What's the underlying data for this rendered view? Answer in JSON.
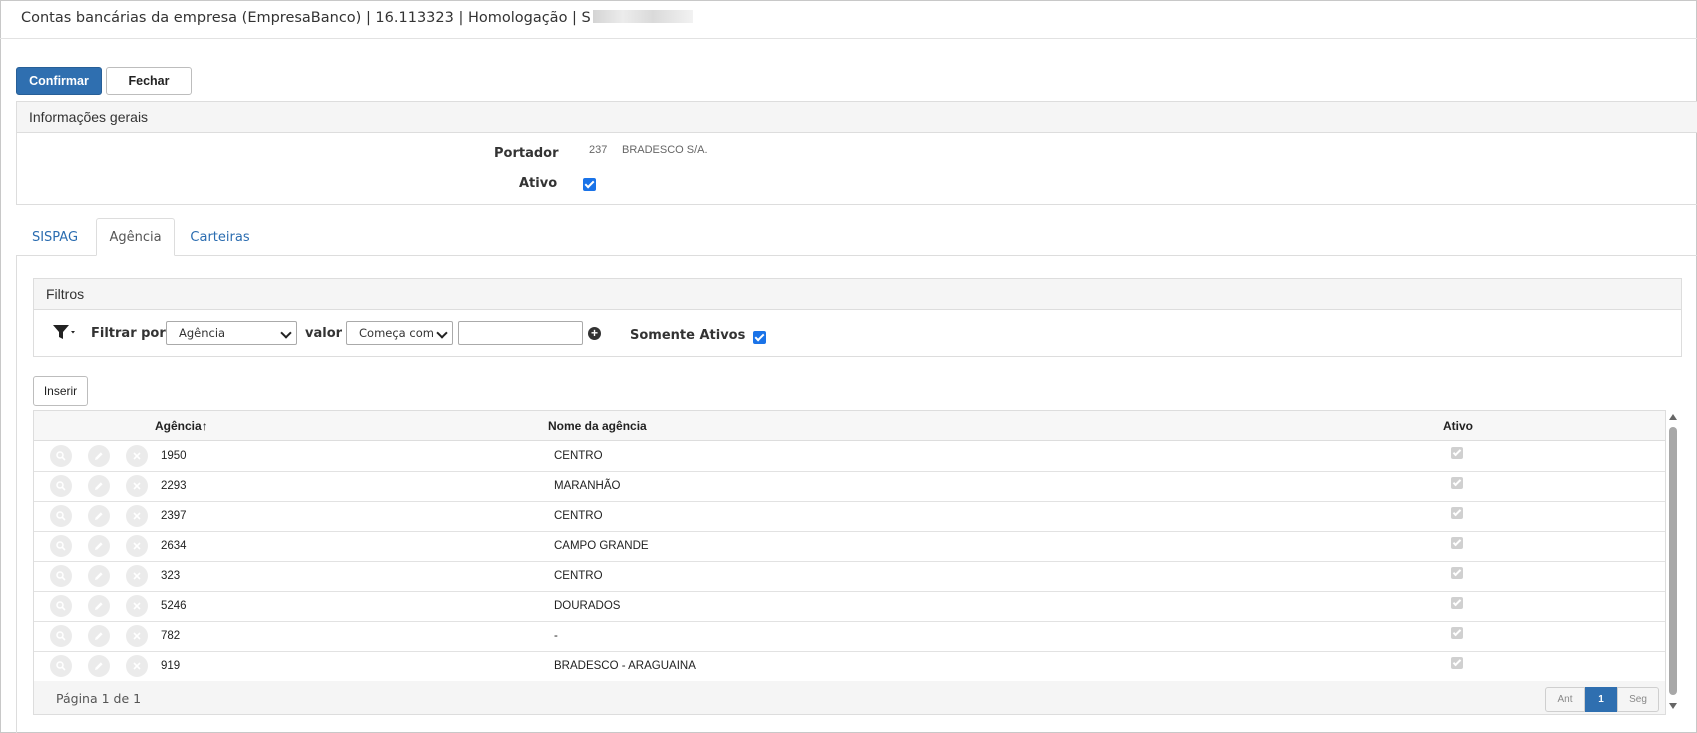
{
  "window": {
    "title": "Contas bancárias da empresa (EmpresaBanco) | 16.113323 | Homologação | S"
  },
  "toolbar": {
    "confirm_label": "Confirmar",
    "close_label": "Fechar"
  },
  "info": {
    "section_title": "Informações gerais",
    "portador_label": "Portador",
    "portador_code": "237",
    "portador_name": "BRADESCO S/A.",
    "ativo_label": "Ativo",
    "ativo_checked": true
  },
  "tabs": [
    {
      "label": "SISPAG",
      "active": false
    },
    {
      "label": "Agência",
      "active": true
    },
    {
      "label": "Carteiras",
      "active": false
    }
  ],
  "filters": {
    "title": "Filtros",
    "filter_by_label": "Filtrar por",
    "filter_by_value": "Agência",
    "value_label": "valor",
    "operator_value": "Começa com",
    "text_value": "",
    "only_active_label": "Somente Ativos",
    "only_active_checked": true
  },
  "insert_label": "Inserir",
  "grid": {
    "columns": [
      "Agência",
      "Nome da agência",
      "Ativo"
    ],
    "sort_indicator": "↑",
    "rows": [
      {
        "agencia": "1950",
        "nome": "CENTRO",
        "ativo": true
      },
      {
        "agencia": "2293",
        "nome": "MARANHÃO",
        "ativo": true
      },
      {
        "agencia": "2397",
        "nome": "CENTRO",
        "ativo": true
      },
      {
        "agencia": "2634",
        "nome": "CAMPO GRANDE",
        "ativo": true
      },
      {
        "agencia": "323",
        "nome": "CENTRO",
        "ativo": true
      },
      {
        "agencia": "5246",
        "nome": "DOURADOS",
        "ativo": true
      },
      {
        "agencia": "782",
        "nome": "-",
        "ativo": true
      },
      {
        "agencia": "919",
        "nome": "BRADESCO - ARAGUAINA",
        "ativo": true
      }
    ],
    "row_actions": [
      "search-icon",
      "pencil-icon",
      "close-icon"
    ]
  },
  "pagination": {
    "info": "Página 1 de 1",
    "prev_label": "Ant",
    "current_page": "1",
    "next_label": "Seg"
  },
  "colors": {
    "primary": "#2f6fb0",
    "tab_link": "#2a6cb0",
    "checkbox": "#1a73e8"
  }
}
